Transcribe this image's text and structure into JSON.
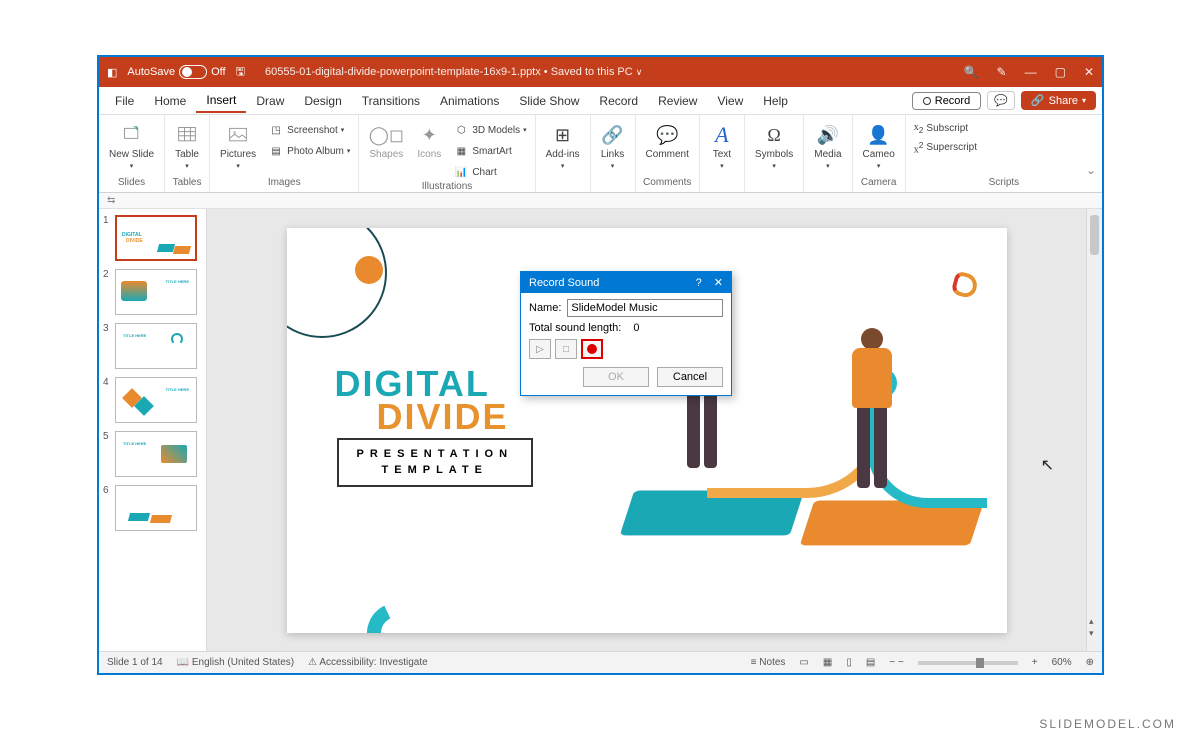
{
  "titleBar": {
    "autoSave": "AutoSave",
    "autoSaveState": "Off",
    "fileName": "60555-01-digital-divide-powerpoint-template-16x9-1.pptx",
    "savedStatus": "Saved to this PC"
  },
  "menu": {
    "file": "File",
    "home": "Home",
    "insert": "Insert",
    "draw": "Draw",
    "design": "Design",
    "transitions": "Transitions",
    "animations": "Animations",
    "slideShow": "Slide Show",
    "record": "Record",
    "review": "Review",
    "view": "View",
    "help": "Help",
    "recordBtn": "Record",
    "share": "Share"
  },
  "ribbon": {
    "slides": {
      "newSlide": "New Slide",
      "group": "Slides"
    },
    "tables": {
      "table": "Table",
      "group": "Tables"
    },
    "images": {
      "pictures": "Pictures",
      "screenshot": "Screenshot",
      "photoAlbum": "Photo Album",
      "group": "Images"
    },
    "illustrations": {
      "shapes": "Shapes",
      "icons": "Icons",
      "models": "3D Models",
      "smartArt": "SmartArt",
      "chart": "Chart",
      "group": "Illustrations"
    },
    "addins": {
      "addins": "Add-ins",
      "group": ""
    },
    "links": {
      "links": "Links",
      "group": ""
    },
    "comments": {
      "comment": "Comment",
      "group": "Comments"
    },
    "text": {
      "text": "Text",
      "group": ""
    },
    "symbols": {
      "symbols": "Symbols",
      "group": ""
    },
    "media": {
      "media": "Media",
      "group": ""
    },
    "camera": {
      "cameo": "Cameo",
      "group": "Camera"
    },
    "scripts": {
      "subscript": "Subscript",
      "superscript": "Superscript",
      "group": "Scripts"
    }
  },
  "dialog": {
    "title": "Record Sound",
    "nameLabel": "Name:",
    "nameValue": "SlideModel Music",
    "lengthLabel": "Total sound length:",
    "lengthValue": "0",
    "ok": "OK",
    "cancel": "Cancel"
  },
  "slide": {
    "title1": "DIGITAL",
    "title2": "DIVIDE",
    "sub1": "PRESENTATION",
    "sub2": "TEMPLATE"
  },
  "thumbs": {
    "n1": "1",
    "n2": "2",
    "n3": "3",
    "n4": "4",
    "n5": "5",
    "n6": "6"
  },
  "status": {
    "slideCount": "Slide 1 of 14",
    "language": "English (United States)",
    "accessibility": "Accessibility: Investigate",
    "notes": "Notes",
    "zoom": "60%"
  },
  "watermark": "SLIDEMODEL.COM"
}
